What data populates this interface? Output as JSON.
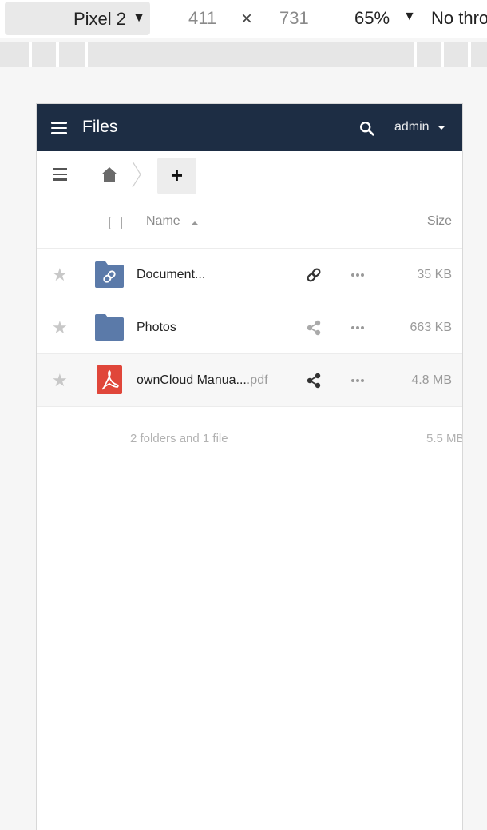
{
  "devtools": {
    "device": "Pixel 2",
    "width": "411",
    "times": "×",
    "height": "731",
    "zoom": "65%",
    "throttle": "No thro"
  },
  "app": {
    "title": "Files",
    "user": "admin",
    "add_label": "+"
  },
  "table": {
    "name_header": "Name",
    "size_header": "Size"
  },
  "files": [
    {
      "name": "Document...",
      "ext": "",
      "size": "35 KB",
      "type": "folder-link",
      "share": "link-icon"
    },
    {
      "name": "Photos",
      "ext": "",
      "size": "663 KB",
      "type": "folder",
      "share": "share-icon"
    },
    {
      "name": "ownCloud Manua...",
      "ext": ".pdf",
      "size": "4.8 MB",
      "type": "pdf",
      "share": "share-icon"
    }
  ],
  "summary": {
    "count": "2 folders and 1 file",
    "total": "5.5 MB"
  },
  "colors": {
    "header_bg": "#1d2d44",
    "folder": "#5b7aa9",
    "pdf": "#e0463a"
  }
}
